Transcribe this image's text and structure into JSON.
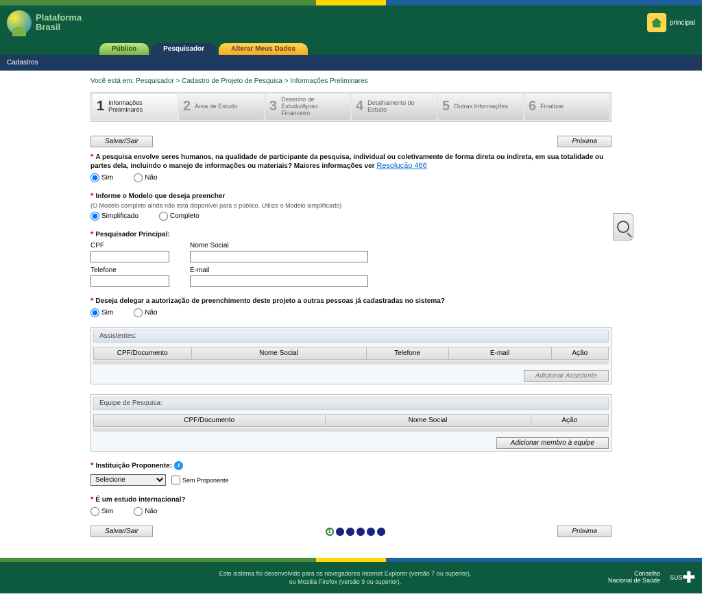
{
  "brand": {
    "line1": "Plataforma",
    "line2": "Brasil"
  },
  "header": {
    "principal": "principal"
  },
  "tabs": {
    "publico": "Público",
    "pesquisador": "Pesquisador",
    "alterar": "Alterar Meus Dados"
  },
  "subnav": "Cadastros",
  "breadcrumb": "Você está em: Pesquisador > Cadastro de Projeto de Pesquisa > Informações Preliminares",
  "steps": [
    {
      "num": "1",
      "label": "Informações Preliminares"
    },
    {
      "num": "2",
      "label": "Área de Estudo"
    },
    {
      "num": "3",
      "label": "Desenho de Estudo/Apoio Financeiro"
    },
    {
      "num": "4",
      "label": "Detalhamento do Estudo"
    },
    {
      "num": "5",
      "label": "Outras Informações"
    },
    {
      "num": "6",
      "label": "Finalizar"
    }
  ],
  "buttons": {
    "salvar": "Salvar/Sair",
    "proxima": "Próxima",
    "addAssist": "Adicionar Assistente",
    "addEquipe": "Adicionar membro à equipe"
  },
  "q1": {
    "label": "A pesquisa envolve seres humanos, na qualidade de participante da pesquisa, individual ou coletivamente de forma direta ou indireta, em sua totalidade ou partes dela, incluindo o manejo de informações ou materiais? Maiores informações ver ",
    "link": "Resolução 466",
    "sim": "Sim",
    "nao": "Não"
  },
  "q2": {
    "label": "Informe o Modelo que deseja preencher",
    "hint": "(O Modelo completo ainda não está disponível para o público. Utilize o Modelo simplificado)",
    "simpl": "Simplificado",
    "comp": "Completo"
  },
  "q3": {
    "label": "Pesquisador Principal:",
    "cpf": "CPF",
    "nome": "Nome Social",
    "tel": "Telefone",
    "email": "E-mail"
  },
  "q4": {
    "label": "Deseja delegar a autorização de preenchimento deste projeto a outras pessoas já cadastradas no sistema?",
    "sim": "Sim",
    "nao": "Não"
  },
  "assist": {
    "title": "Assistentes:",
    "cols": {
      "cpf": "CPF/Documento",
      "nome": "Nome Social",
      "tel": "Telefone",
      "email": "E-mail",
      "acao": "Ação"
    }
  },
  "equipe": {
    "title": "Equipe de Pesquisa:",
    "cols": {
      "cpf": "CPF/Documento",
      "nome": "Nome Social",
      "acao": "Ação"
    }
  },
  "inst": {
    "label": "Instituição Proponente:",
    "sel": "Selecione",
    "sem": "Sem Proponente"
  },
  "intl": {
    "label": "É um estudo internacional?",
    "sim": "Sim",
    "nao": "Não"
  },
  "pager_active": "1",
  "footer": {
    "l1": "Este sistema foi desenvolvido para os navegadores Internet Explorer (versão 7 ou superior),",
    "l2": "ou Mozilla Firefox (versão 9 ou superior).",
    "logo1a": "Conselho",
    "logo1b": "Nacional de Saúde",
    "logo2": "SUS"
  }
}
